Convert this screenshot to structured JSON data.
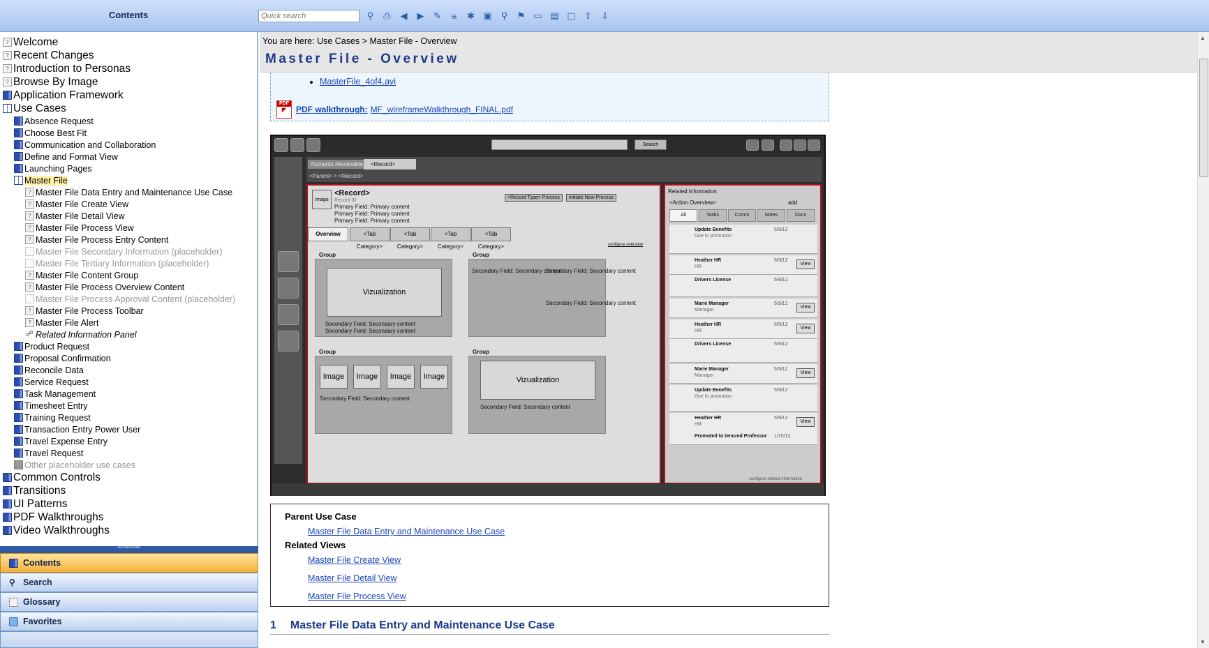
{
  "header": {
    "contents_title": "Contents",
    "search_placeholder": "Quick search"
  },
  "toolbar_icons": [
    "find-icon",
    "print-icon",
    "previous-icon",
    "next-icon",
    "highlight-icon",
    "collapse-icon",
    "new-topic-icon",
    "open-folder-icon",
    "zoom-icon",
    "marker-icon",
    "window-icon",
    "book-icon",
    "note-icon",
    "export-icon",
    "import-icon"
  ],
  "tree": [
    {
      "label": "Welcome",
      "level": 0,
      "icon": "page"
    },
    {
      "label": "Recent Changes",
      "level": 0,
      "icon": "page"
    },
    {
      "label": "Introduction to Personas",
      "level": 0,
      "icon": "page"
    },
    {
      "label": "Browse By Image",
      "level": 0,
      "icon": "page"
    },
    {
      "label": "Application Framework",
      "level": 0,
      "icon": "book"
    },
    {
      "label": "Use Cases",
      "level": 0,
      "icon": "open"
    },
    {
      "label": "Absence Request",
      "level": 1,
      "icon": "book"
    },
    {
      "label": "Choose Best Fit",
      "level": 1,
      "icon": "book"
    },
    {
      "label": "Communication and Collaboration",
      "level": 1,
      "icon": "book"
    },
    {
      "label": "Define and Format View",
      "level": 1,
      "icon": "book"
    },
    {
      "label": "Launching Pages",
      "level": 1,
      "icon": "book"
    },
    {
      "label": "Master File",
      "level": 1,
      "icon": "open",
      "selected": true
    },
    {
      "label": "Master File Data Entry and Maintenance Use Case",
      "level": 2,
      "icon": "page"
    },
    {
      "label": "Master File Create View",
      "level": 2,
      "icon": "page"
    },
    {
      "label": "Master File Detail View",
      "level": 2,
      "icon": "page"
    },
    {
      "label": "Master File Process View",
      "level": 2,
      "icon": "page"
    },
    {
      "label": "Master File Process Entry Content",
      "level": 2,
      "icon": "page"
    },
    {
      "label": "Master File Secondary Information (placeholder)",
      "level": 2,
      "icon": "phold",
      "dim": true
    },
    {
      "label": "Master File Tertiary Information (placeholder)",
      "level": 2,
      "icon": "phold",
      "dim": true
    },
    {
      "label": "Master File Content Group",
      "level": 2,
      "icon": "page"
    },
    {
      "label": "Master File Process Overview Content",
      "level": 2,
      "icon": "page"
    },
    {
      "label": "Master File Process Approval Content (placeholder)",
      "level": 2,
      "icon": "phold",
      "dim": true
    },
    {
      "label": "Master File Process Toolbar",
      "level": 2,
      "icon": "page"
    },
    {
      "label": "Master File Alert",
      "level": 2,
      "icon": "page"
    },
    {
      "label": "Related Information Panel",
      "level": 2,
      "icon": "plug",
      "italic": true
    },
    {
      "label": "Product Request",
      "level": 1,
      "icon": "book"
    },
    {
      "label": "Proposal Confirmation",
      "level": 1,
      "icon": "book"
    },
    {
      "label": "Reconcile Data",
      "level": 1,
      "icon": "book"
    },
    {
      "label": "Service Request",
      "level": 1,
      "icon": "book"
    },
    {
      "label": "Task Management",
      "level": 1,
      "icon": "book"
    },
    {
      "label": "Timesheet Entry",
      "level": 1,
      "icon": "book"
    },
    {
      "label": "Training Request",
      "level": 1,
      "icon": "book"
    },
    {
      "label": "Transaction Entry Power User",
      "level": 1,
      "icon": "book"
    },
    {
      "label": "Travel Expense Entry",
      "level": 1,
      "icon": "book"
    },
    {
      "label": "Travel Request",
      "level": 1,
      "icon": "book"
    },
    {
      "label": "Other placeholder use cases",
      "level": 1,
      "icon": "gray",
      "dim": true
    },
    {
      "label": "Common Controls",
      "level": 0,
      "icon": "book"
    },
    {
      "label": "Transitions",
      "level": 0,
      "icon": "book"
    },
    {
      "label": "UI Patterns",
      "level": 0,
      "icon": "book"
    },
    {
      "label": "PDF Walkthroughs",
      "level": 0,
      "icon": "book"
    },
    {
      "label": "Video Walkthroughs",
      "level": 0,
      "icon": "book"
    }
  ],
  "nav_tabs": {
    "contents": "Contents",
    "search": "Search",
    "glossary": "Glossary",
    "favorites": "Favorites"
  },
  "page": {
    "breadcrumb": "You are here: Use Cases > Master File - Overview",
    "title": "Master File - Overview",
    "video_link": "MasterFile_4of4.avi",
    "pdf_bold": "PDF walkthrough:",
    "pdf_link": "MF_wireframeWalkthrough_FINAL.pdf",
    "parent_use_case_heading": "Parent Use Case",
    "parent_use_case_link": "Master File Data Entry and Maintenance Use Case",
    "related_views_heading": "Related Views",
    "related_views": [
      "Master File Create View",
      "Master File Detail View",
      "Master File Process View"
    ],
    "section_number": "1",
    "section_title": "Master File Data Entry and Maintenance Use Case"
  },
  "wireframe": {
    "search_btn": "Search",
    "tab_ar": "Accounts Receivable",
    "tab_record": "<Record>",
    "crumbs": "<Parent> > <Record>",
    "image": "Image",
    "record": "<Record>",
    "record_id": "Record ID",
    "primary": "Primary Field: Primary content",
    "btn_process": "<Record Type> Process",
    "btn_initiate": "Initiate New Process",
    "tabs": [
      "Overview",
      "<Tab Category>",
      "<Tab Category>",
      "<Tab Category>",
      "<Tab Category>"
    ],
    "configure_overview": "configure overview",
    "group": "Group",
    "viz": "Vizualization",
    "secondary": "Secondary Field: Secondary content",
    "related_title": "Related Information",
    "action_overview": "<Action Overview>",
    "add": "add",
    "rel_tabs": [
      "All",
      "Tasks",
      "Comm",
      "Notes",
      "Docs"
    ],
    "rows": [
      {
        "t": "Update Benefits",
        "s": "Due to promotion",
        "d": "5/9/12",
        "v": ""
      },
      {
        "t": "Heather HR",
        "s": "HR",
        "d": "5/9/12",
        "v": "View"
      },
      {
        "t": "Drivers License",
        "s": "",
        "d": "5/9/12",
        "v": ""
      },
      {
        "t": "Marie Manager",
        "s": "Manager",
        "d": "5/9/12",
        "v": "View"
      },
      {
        "t": "Heather HR",
        "s": "HR",
        "d": "5/9/12",
        "v": "View"
      },
      {
        "t": "Drivers License",
        "s": "",
        "d": "5/9/12",
        "v": ""
      },
      {
        "t": "Marie Manager",
        "s": "Manager",
        "d": "5/9/12",
        "v": "View"
      },
      {
        "t": "Update Benefits",
        "s": "Due to promotion",
        "d": "5/9/12",
        "v": ""
      },
      {
        "t": "Heather HR",
        "s": "HR",
        "d": "5/9/12",
        "v": "View"
      },
      {
        "t": "Promoted to tenured Professor",
        "s": "",
        "d": "1/15/12",
        "v": ""
      }
    ],
    "configure_related": "configure related information"
  }
}
